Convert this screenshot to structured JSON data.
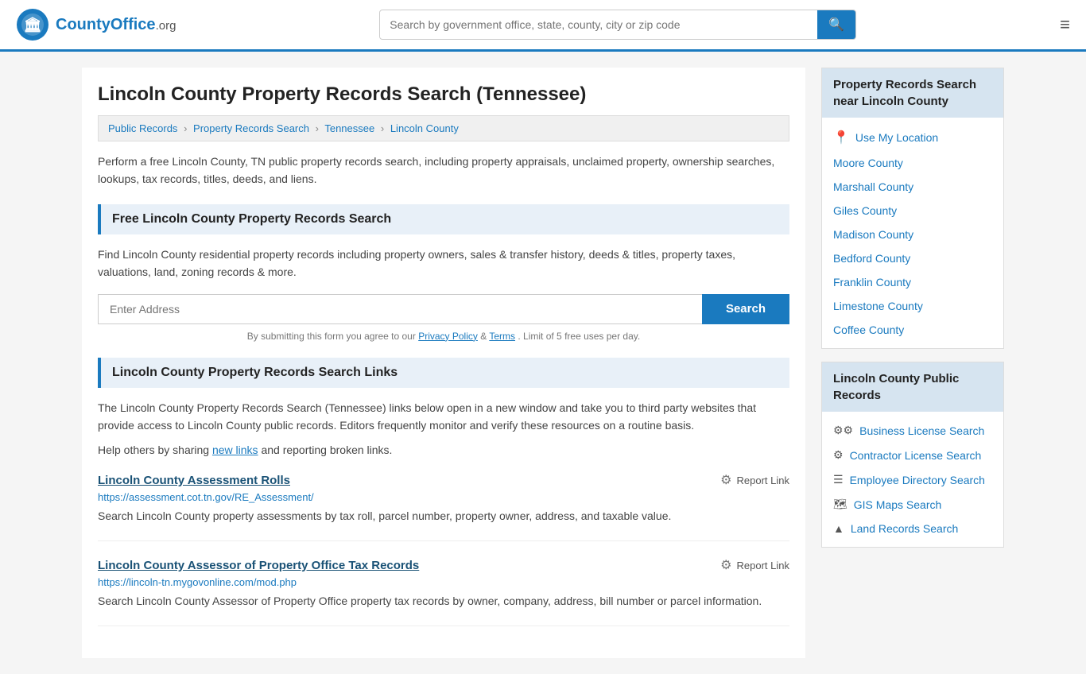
{
  "header": {
    "logo_text": "CountyOffice",
    "logo_suffix": ".org",
    "search_placeholder": "Search by government office, state, county, city or zip code",
    "menu_icon": "≡"
  },
  "page": {
    "title": "Lincoln County Property Records Search (Tennessee)",
    "breadcrumbs": [
      {
        "label": "Public Records",
        "href": "#"
      },
      {
        "label": "Property Records Search",
        "href": "#"
      },
      {
        "label": "Tennessee",
        "href": "#"
      },
      {
        "label": "Lincoln County",
        "href": "#"
      }
    ],
    "description": "Perform a free Lincoln County, TN public property records search, including property appraisals, unclaimed property, ownership searches, lookups, tax records, titles, deeds, and liens.",
    "free_search_title": "Free Lincoln County Property Records Search",
    "free_search_desc": "Find Lincoln County residential property records including property owners, sales & transfer history, deeds & titles, property taxes, valuations, land, zoning records & more.",
    "address_placeholder": "Enter Address",
    "search_btn_label": "Search",
    "form_disclaimer": "By submitting this form you agree to our",
    "privacy_policy_label": "Privacy Policy",
    "terms_label": "Terms",
    "form_disclaimer_suffix": ". Limit of 5 free uses per day.",
    "links_title": "Lincoln County Property Records Search Links",
    "links_desc": "The Lincoln County Property Records Search (Tennessee) links below open in a new window and take you to third party websites that provide access to Lincoln County public records. Editors frequently monitor and verify these resources on a routine basis.",
    "share_text": "Help others by sharing",
    "new_links_label": "new links",
    "share_text2": "and reporting broken links.",
    "record_links": [
      {
        "title": "Lincoln County Assessment Rolls",
        "url": "https://assessment.cot.tn.gov/RE_Assessment/",
        "description": "Search Lincoln County property assessments by tax roll, parcel number, property owner, address, and taxable value."
      },
      {
        "title": "Lincoln County Assessor of Property Office Tax Records",
        "url": "https://lincoln-tn.mygovonline.com/mod.php",
        "description": "Search Lincoln County Assessor of Property Office property tax records by owner, company, address, bill number or parcel information."
      }
    ],
    "report_link_label": "Report Link"
  },
  "sidebar": {
    "nearby_title": "Property Records Search near Lincoln County",
    "use_my_location": "Use My Location",
    "nearby_counties": [
      {
        "label": "Moore County"
      },
      {
        "label": "Marshall County"
      },
      {
        "label": "Giles County"
      },
      {
        "label": "Madison County"
      },
      {
        "label": "Bedford County"
      },
      {
        "label": "Franklin County"
      },
      {
        "label": "Limestone County"
      },
      {
        "label": "Coffee County"
      }
    ],
    "public_records_title": "Lincoln County Public Records",
    "public_records_links": [
      {
        "icon": "⚙",
        "label": "Business License Search"
      },
      {
        "icon": "⚙",
        "label": "Contractor License Search"
      },
      {
        "icon": "☰",
        "label": "Employee Directory Search"
      },
      {
        "icon": "🗺",
        "label": "GIS Maps Search"
      },
      {
        "icon": "▲",
        "label": "Land Records Search"
      }
    ]
  }
}
